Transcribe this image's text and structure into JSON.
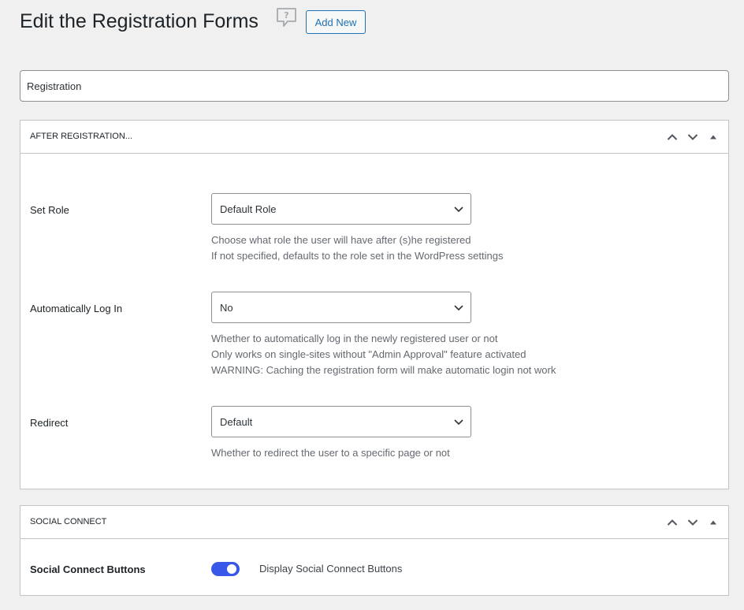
{
  "page": {
    "title": "Edit the Registration Forms",
    "add_new_label": "Add New",
    "help_icon": "help-question-bubble-icon"
  },
  "form_title": {
    "value": "Registration"
  },
  "after_registration": {
    "title": "AFTER REGISTRATION...",
    "handle_icons": [
      "chevron-up-icon",
      "chevron-down-icon",
      "collapse-triangle-icon"
    ],
    "fields": [
      {
        "label": "Set Role",
        "selected": "Default Role",
        "description": [
          "Choose what role the user will have after (s)he registered",
          "If not specified, defaults to the role set in the WordPress settings"
        ]
      },
      {
        "label": "Automatically Log In",
        "selected": "No",
        "description": [
          "Whether to automatically log in the newly registered user or not",
          "Only works on single-sites without \"Admin Approval\" feature activated",
          "WARNING: Caching the registration form will make automatic login not work"
        ]
      },
      {
        "label": "Redirect",
        "selected": "Default",
        "description": [
          "Whether to redirect the user to a specific page or not"
        ]
      }
    ]
  },
  "social_connect": {
    "title": "SOCIAL CONNECT",
    "field_label": "Social Connect Buttons",
    "toggle_on": true,
    "toggle_label": "Display Social Connect Buttons"
  },
  "colors": {
    "background": "#f0f0f1",
    "accent": "#2271b1",
    "toggle_on": "#3858e9",
    "border": "#c3c4c7"
  }
}
